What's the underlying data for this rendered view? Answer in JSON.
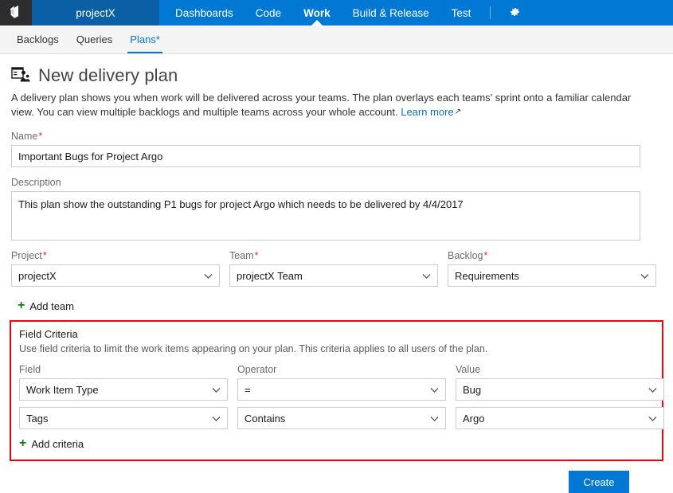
{
  "topnav": {
    "logo_icon": "vsts-logo-icon",
    "account": "projectX",
    "items": [
      {
        "label": "Dashboards",
        "active": false
      },
      {
        "label": "Code",
        "active": false
      },
      {
        "label": "Work",
        "active": true
      },
      {
        "label": "Build & Release",
        "active": false
      },
      {
        "label": "Test",
        "active": false
      }
    ],
    "settings_icon": "gear-icon"
  },
  "subnav": {
    "tabs": [
      {
        "label": "Backlogs",
        "active": false
      },
      {
        "label": "Queries",
        "active": false
      },
      {
        "label": "Plans*",
        "active": true
      }
    ]
  },
  "page": {
    "title_icon": "delivery-plan-icon",
    "title": "New delivery plan",
    "description": "A delivery plan shows you when work will be delivered across your teams. The plan overlays each teams' sprint onto a familiar calendar view. You can view multiple backlogs and multiple teams across your whole account.",
    "learn_more": "Learn more",
    "external_link_icon": "external-link-icon"
  },
  "form": {
    "name": {
      "label": "Name",
      "required_mark": "*",
      "value": "Important Bugs for Project Argo"
    },
    "description": {
      "label": "Description",
      "value": "This plan show the outstanding P1 bugs for project Argo which needs to be delivered by 4/4/2017"
    },
    "project": {
      "label": "Project",
      "required_mark": "*",
      "value": "projectX"
    },
    "team": {
      "label": "Team",
      "required_mark": "*",
      "value": "projectX Team"
    },
    "backlog": {
      "label": "Backlog",
      "required_mark": "*",
      "value": "Requirements"
    },
    "add_team": {
      "plus": "+",
      "label": "Add team"
    }
  },
  "criteria": {
    "title": "Field Criteria",
    "subtitle": "Use field criteria to limit the work items appearing on your plan. This criteria applies to all users of the plan.",
    "headers": {
      "field": "Field",
      "operator": "Operator",
      "value": "Value"
    },
    "rows": [
      {
        "field": "Work Item Type",
        "operator": "=",
        "value": "Bug",
        "delete_glyph": "✕"
      },
      {
        "field": "Tags",
        "operator": "Contains",
        "value": "Argo",
        "delete_glyph": "✕"
      }
    ],
    "add_criteria": {
      "plus": "+",
      "label": "Add criteria"
    },
    "highlight_color": "#ff0000"
  },
  "footer": {
    "create_label": "Create"
  },
  "colors": {
    "nav_blue": "#0078d4",
    "account_blue": "#0b5fa5",
    "logo_dark": "#2d2d30",
    "subbar_grey": "#f4f4f4",
    "required_red": "#d13438",
    "plus_green": "#107c10",
    "delete_red": "#c00000",
    "link_blue": "#0a6ebd"
  }
}
